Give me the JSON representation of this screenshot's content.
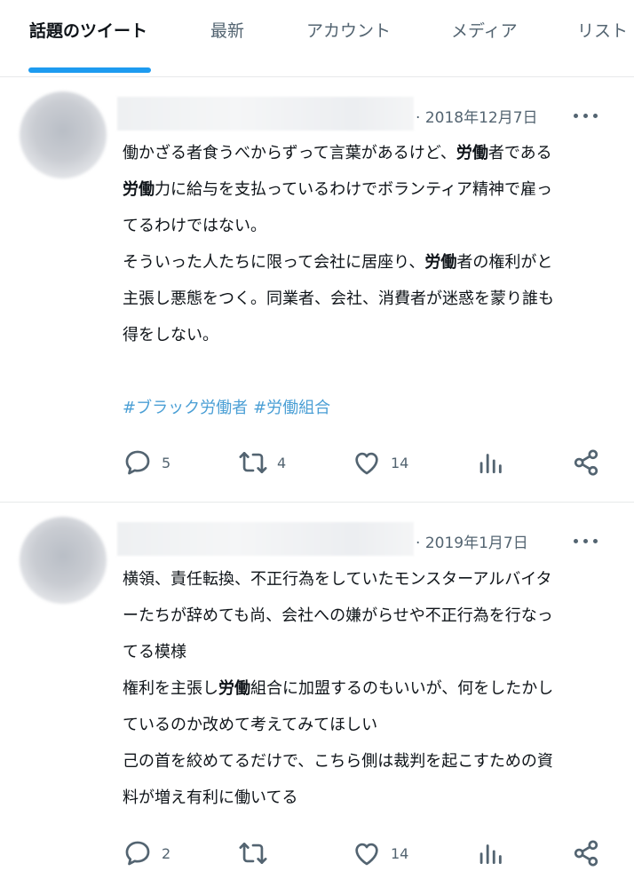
{
  "tabs": [
    {
      "label": "話題のツイート",
      "active": true
    },
    {
      "label": "最新"
    },
    {
      "label": "アカウント"
    },
    {
      "label": "メディア"
    },
    {
      "label": "リスト"
    }
  ],
  "colors": {
    "accent": "#1d9bf0",
    "hashtag": "#4b9fd5",
    "muted": "#536471"
  },
  "tweets": [
    {
      "date": "2018年12月7日",
      "body_lines": [
        [
          "働かざる者食うべからずって言葉があるけど、",
          "労働",
          "者である"
        ],
        [
          "",
          "労働",
          "力に給与を支払っているわけでボランティア精神で雇っ"
        ],
        [
          "てるわけではない。",
          "",
          ""
        ],
        [
          "そういった人たちに限って会社に居座り、",
          "労働",
          "者の権利がと"
        ],
        [
          "主張し悪態をつく。同業者、会社、消費者が迷惑を蒙り誰も",
          "",
          ""
        ],
        [
          "得をしない。",
          "",
          ""
        ]
      ],
      "hashtags": [
        "#ブラック労働者",
        "#労働組合"
      ],
      "replies": "5",
      "retweets": "4",
      "likes": "14"
    },
    {
      "date": "2019年1月7日",
      "body_lines": [
        [
          "横領、責任転換、不正行為をしていたモンスターアルバイタ",
          "",
          ""
        ],
        [
          "ーたちが辞めても尚、会社への嫌がらせや不正行為を行なっ",
          "",
          ""
        ],
        [
          "てる模様",
          "",
          ""
        ],
        [
          "権利を主張し",
          "労働",
          "組合に加盟するのもいいが、何をしたかし"
        ],
        [
          "ているのか改めて考えてみてほしい",
          "",
          ""
        ],
        [
          "己の首を絞めてるだけで、こちら側は裁判を起こすための資",
          "",
          ""
        ],
        [
          "料が増え有利に働いてる",
          "",
          ""
        ]
      ],
      "replies": "2",
      "retweets": "",
      "likes": "14"
    }
  ]
}
